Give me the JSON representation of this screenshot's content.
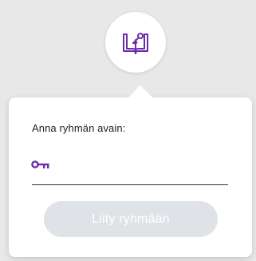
{
  "form": {
    "label": "Anna ryhmän avain:",
    "key_value": "",
    "key_placeholder": "",
    "join_button_label": "Liity ryhmään",
    "join_button_enabled": false
  },
  "icons": {
    "top": "book-key-icon",
    "field": "key-icon"
  },
  "colors": {
    "accent": "#6a2ca8",
    "button_disabled_bg": "#dfe2e6",
    "button_disabled_text": "#ffffff",
    "underline": "#333333"
  }
}
